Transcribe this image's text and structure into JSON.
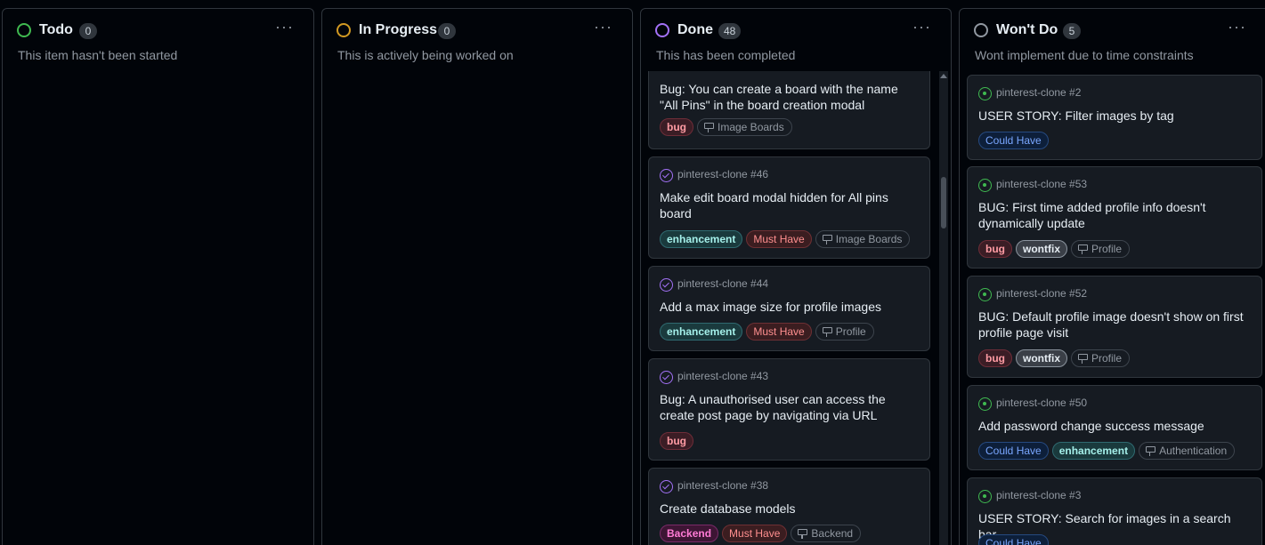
{
  "columns": {
    "todo": {
      "title": "Todo",
      "count": "0",
      "description": "This item hasn't been started",
      "color": "#3fb950"
    },
    "progress": {
      "title": "In Progress",
      "count": "0",
      "description": "This is actively being worked on",
      "color": "#d29922"
    },
    "done": {
      "title": "Done",
      "count": "48",
      "description": "This has been completed",
      "color": "#a371f7",
      "cards": [
        {
          "meta": "",
          "title": "Bug: You can create a board with the name \"All Pins\" in the board creation modal",
          "labels": [
            "bug"
          ],
          "field": "Image Boards"
        },
        {
          "meta": "pinterest-clone #46",
          "title": "Make edit board modal hidden for All pins board",
          "labels": [
            "enhancement",
            "Must Have"
          ],
          "field": "Image Boards"
        },
        {
          "meta": "pinterest-clone #44",
          "title": "Add a max image size for profile images",
          "labels": [
            "enhancement",
            "Must Have"
          ],
          "field": "Profile"
        },
        {
          "meta": "pinterest-clone #43",
          "title": "Bug: A unauthorised user can access the create post page by navigating via URL",
          "labels": [
            "bug"
          ]
        },
        {
          "meta": "pinterest-clone #38",
          "title": "Create database models",
          "labels": [
            "Backend",
            "Must Have"
          ],
          "field": "Backend"
        }
      ]
    },
    "wont": {
      "title": "Won't Do",
      "count": "5",
      "description": "Wont implement due to time constraints",
      "color": "#9198a1",
      "cards": [
        {
          "meta": "pinterest-clone #2",
          "title": "USER STORY: Filter images by tag",
          "labels": [
            "Could Have"
          ]
        },
        {
          "meta": "pinterest-clone #53",
          "title": "BUG: First time added profile info doesn't dynamically update",
          "labels": [
            "bug",
            "wontfix"
          ],
          "field": "Profile"
        },
        {
          "meta": "pinterest-clone #52",
          "title": "BUG: Default profile image doesn't show on first profile page visit",
          "labels": [
            "bug",
            "wontfix"
          ],
          "field": "Profile"
        },
        {
          "meta": "pinterest-clone #50",
          "title": "Add password change success message",
          "labels": [
            "Could Have",
            "enhancement"
          ],
          "field": "Authentication"
        },
        {
          "meta": "pinterest-clone #3",
          "title": "USER STORY: Search for images in a search bar",
          "labels": [
            "Could Have"
          ]
        }
      ]
    }
  }
}
